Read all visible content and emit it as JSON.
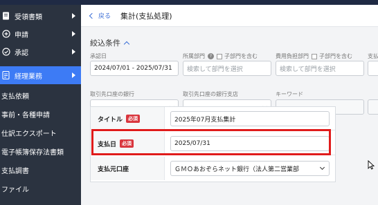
{
  "topbar": {
    "title": ""
  },
  "sidebar": {
    "items": [
      {
        "label": "受領書類",
        "icon": "document-icon",
        "has_arrow": true
      },
      {
        "label": "申請",
        "icon": "plus-circle-icon",
        "has_arrow": true
      },
      {
        "label": "承認",
        "icon": "check-circle-icon",
        "has_arrow": true
      },
      {
        "label": "経理業務",
        "icon": "list-icon",
        "has_arrow": true,
        "active": true
      }
    ],
    "subitems": [
      "支払依頼",
      "事前・各種申請",
      "仕訳エクスポート",
      "電子帳簿保存法書類",
      "支払調書",
      "ファイル"
    ]
  },
  "header": {
    "back_label": "戻る",
    "title": "集計(支払処理)"
  },
  "filter": {
    "title": "絞込条件",
    "approval_date": {
      "label": "承認日",
      "value": "2024/07/01 - 2025/07/31"
    },
    "department": {
      "label": "所属部門",
      "child_label": "子部門を含む",
      "placeholder": "検索して部門を選択"
    },
    "cost_department": {
      "label": "費用負担部門",
      "child_label": "子部門を含む",
      "placeholder": "検索して部門を選択"
    },
    "extra_label": "支払",
    "bank": {
      "label": "取引先口座の銀行"
    },
    "branch": {
      "label": "取引先口座の銀行支店"
    },
    "keyword": {
      "label": "キーワード"
    }
  },
  "form": {
    "required_badge": "必須",
    "title_row": {
      "label": "タイトル",
      "value": "2025年07月支払集計"
    },
    "date_row": {
      "label": "支払日",
      "value": "2025/07/31"
    },
    "account_row": {
      "label": "支払元口座",
      "value": "ＧＭＯあおぞらネット銀行（法人第二営業部"
    }
  },
  "colors": {
    "sidebar_bg": "#2b3340",
    "active": "#3d7bf5",
    "highlight": "#e01b1b",
    "required": "#d9363e"
  }
}
